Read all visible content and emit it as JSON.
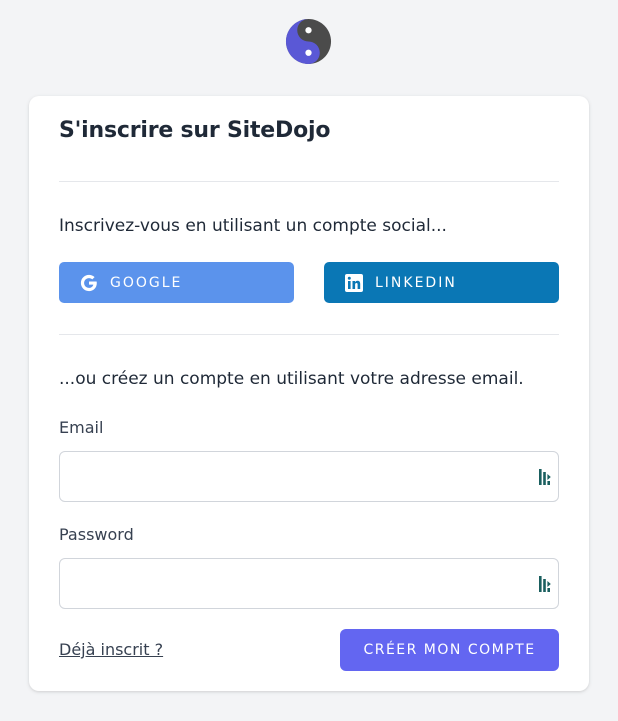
{
  "brand": {
    "logo_icon": "yin-yang-icon",
    "accent": "#6366f1"
  },
  "signup": {
    "title": "S'inscrire sur SiteDojo",
    "social_intro": "Inscrivez-vous en utilisant un compte social...",
    "google_label": "GOOGLE",
    "google_color": "#5b93ec",
    "linkedin_label": "LINKEDIN",
    "linkedin_color": "#0a77b5",
    "email_intro": "...ou créez un compte en utilisant votre adresse email.",
    "email_label": "Email",
    "email_value": "",
    "password_label": "Password",
    "password_value": "",
    "already_registered": "Déjà inscrit ?",
    "submit_label": "CRÉER MON COMPTE"
  }
}
